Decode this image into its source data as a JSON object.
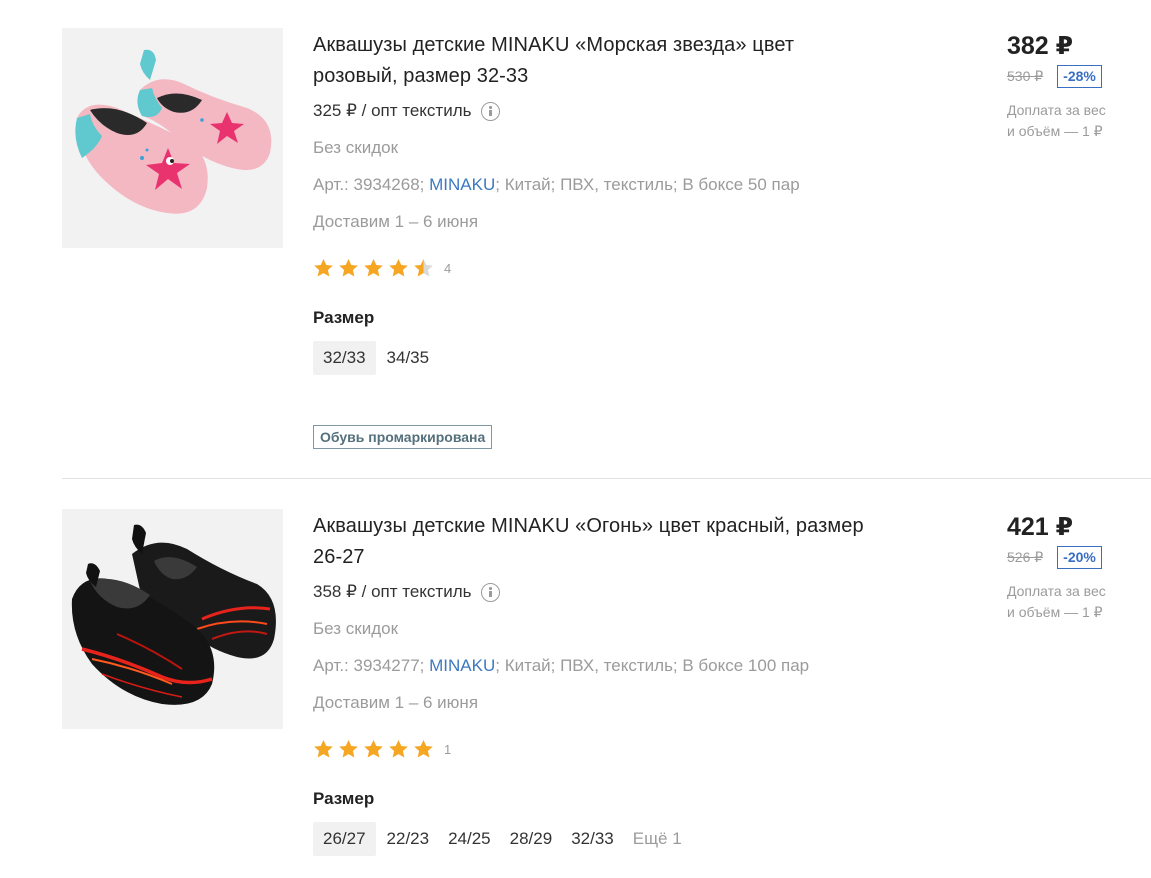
{
  "products": [
    {
      "title": "Аквашузы детские MINAKU «Морская звезда» цвет розовый, размер 32-33",
      "unit_price": "325 ₽ / опт текстиль",
      "discount_note": "Без скидок",
      "meta": {
        "art": "Арт.: 3934268; ",
        "brand": "MINAKU",
        "rest": "; Китай; ПВХ, текстиль; В боксе 50 пар"
      },
      "delivery": "Доставим 1 – 6 июня",
      "rating": 4.5,
      "rating_count": "4",
      "size_label": "Размер",
      "sizes": [
        "32/33",
        "34/35"
      ],
      "badge": "Обувь промаркирована",
      "price": "382 ₽",
      "old_price": "530 ₽",
      "discount": "-28%",
      "surcharge_1": "Доплата за вес",
      "surcharge_2": "и объём — 1 ₽",
      "image_icon": "pink-aqua-shoes-starfish"
    },
    {
      "title": "Аквашузы детские MINAKU «Огонь» цвет красный, размер 26-27",
      "unit_price": "358 ₽ / опт текстиль",
      "discount_note": "Без скидок",
      "meta": {
        "art": "Арт.: 3934277; ",
        "brand": "MINAKU",
        "rest": "; Китай; ПВХ, текстиль; В боксе 100 пар"
      },
      "delivery": "Доставим 1 – 6 июня",
      "rating": 5,
      "rating_count": "1",
      "size_label": "Размер",
      "sizes": [
        "26/27",
        "22/23",
        "24/25",
        "28/29",
        "32/33"
      ],
      "sizes_more": "Ещё 1",
      "price": "421 ₽",
      "old_price": "526 ₽",
      "discount": "-20%",
      "surcharge_1": "Доплата за вес",
      "surcharge_2": "и объём — 1 ₽",
      "image_icon": "black-red-fire-aqua-shoes"
    }
  ],
  "colors": {
    "star": "#f5a623",
    "link": "#3d78c1",
    "discount": "#3a6ec3",
    "muted": "#9b9b9b"
  }
}
